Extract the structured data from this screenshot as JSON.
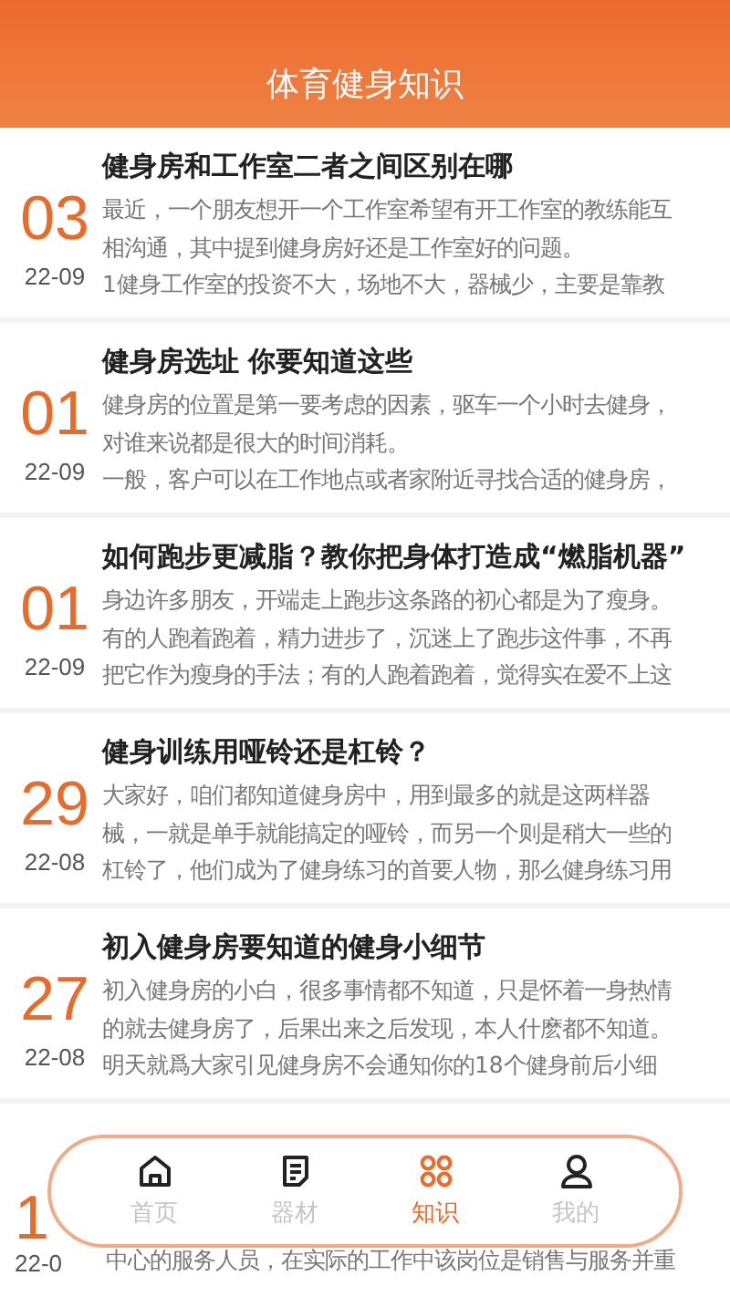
{
  "header": {
    "title": "体育健身知识"
  },
  "articles": [
    {
      "day": "03",
      "date": "22-09",
      "title": "健身房和工作室二者之间区别在哪",
      "summary_lines": [
        "最近，一个朋友想开一个工作室希望有开工作室的教练能互",
        "相沟通，其中提到健身房好还是工作室好的问题。",
        "1健身工作室的投资不大，场地不大，器械少，主要是靠教"
      ]
    },
    {
      "day": "01",
      "date": "22-09",
      "title": "健身房选址 你要知道这些",
      "summary_lines": [
        "健身房的位置是第一要考虑的因素，驱车一个小时去健身，",
        "对谁来说都是很大的时间消耗。",
        "一般，客户可以在工作地点或者家附近寻找合适的健身房，"
      ]
    },
    {
      "day": "01",
      "date": "22-09",
      "title": "如何跑步更减脂？教你把身体打造成“燃脂机器”",
      "summary_lines": [
        "身边许多朋友，开端走上跑步这条路的初心都是为了瘦身。",
        "有的人跑着跑着，精力进步了，沉迷上了跑步这件事，不再",
        "把它作为瘦身的手法；有的人跑着跑着，觉得实在爱不上这"
      ]
    },
    {
      "day": "29",
      "date": "22-08",
      "title": "健身训练用哑铃还是杠铃？",
      "summary_lines": [
        "大家好，咱们都知道健身房中，用到最多的就是这两样器",
        "械，一就是单手就能搞定的哑铃，而另一个则是稍大一些的",
        "杠铃了，他们成为了健身练习的首要人物，那么健身练习用"
      ]
    },
    {
      "day": "27",
      "date": "22-08",
      "title": "初入健身房要知道的健身小细节",
      "summary_lines": [
        "初入健身房的小白，很多事情都不知道，只是怀着一身热情",
        "的就去健身房了，后果出来之后发现，本人什麽都不知道。",
        "明天就爲大家引见健身房不会通知你的18个健身前后小细"
      ]
    },
    {
      "day": "1",
      "date": "22-0",
      "summary_lines": [
        "中心的服务人员，在实际的工作中该岗位是销售与服务并重"
      ]
    }
  ],
  "tabbar": [
    {
      "kind": "home",
      "label": "首页",
      "selected": false
    },
    {
      "kind": "list",
      "label": "器材",
      "selected": false
    },
    {
      "kind": "grid",
      "label": "知识",
      "selected": true
    },
    {
      "kind": "user",
      "label": "我的",
      "selected": false
    }
  ]
}
